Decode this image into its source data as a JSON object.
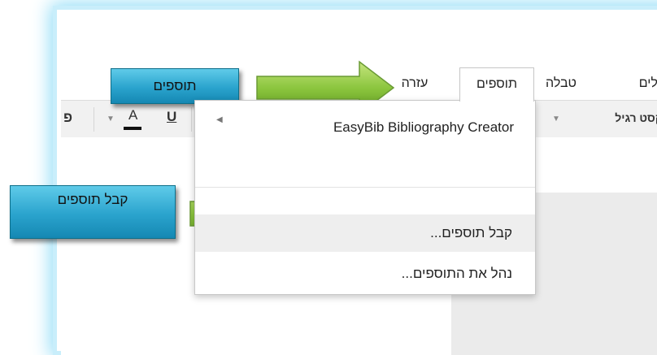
{
  "menubar": {
    "items": [
      {
        "label": "עזרה",
        "active": false
      },
      {
        "label": "תוספים",
        "active": true
      },
      {
        "label": "טבלה",
        "active": false
      },
      {
        "label": "כלים",
        "active": false
      }
    ]
  },
  "toolbar": {
    "style_label": "קסט רגיל",
    "font_color_label": "A",
    "underline_label": "U",
    "left_fragment": "פ"
  },
  "dropdown": {
    "items": [
      {
        "label": "EasyBib Bibliography Creator",
        "submenu": true
      },
      {
        "label": "קבל תוספים...",
        "highlighted": true
      },
      {
        "label": "נהל את התוספים...",
        "highlighted": false
      }
    ]
  },
  "callouts": {
    "addons": "תוספים",
    "get_addons": "קבל תוספים"
  },
  "colors": {
    "callout": "#2aa3cd",
    "arrow": "#8cc63f",
    "frame_glow": "#8fdcf7"
  }
}
